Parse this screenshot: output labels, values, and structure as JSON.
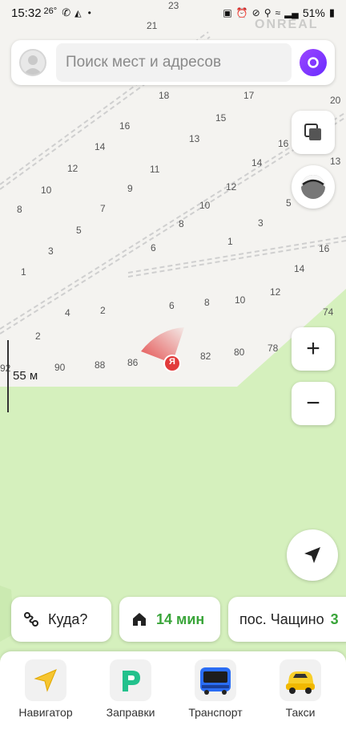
{
  "status_bar": {
    "time": "15:32",
    "temperature": "26°",
    "battery": "51%"
  },
  "watermark": "ONREAL",
  "search": {
    "placeholder": "Поиск мест и адресов"
  },
  "map": {
    "scale_label": "55 м",
    "location_marker_letter": "Я",
    "house_numbers": [
      "23",
      "21",
      "18",
      "17",
      "20",
      "16",
      "15",
      "16",
      "13",
      "14",
      "12",
      "11",
      "14",
      "12",
      "10",
      "9",
      "13",
      "8",
      "7",
      "10",
      "5",
      "3",
      "5",
      "8",
      "6",
      "1",
      "16",
      "3",
      "14",
      "1",
      "12",
      "2",
      "4",
      "6",
      "8",
      "10",
      "74",
      "2",
      "82",
      "80",
      "78",
      "92",
      "90",
      "88",
      "86"
    ]
  },
  "chips": {
    "route_label": "Куда?",
    "home_time": "14 мин",
    "place_label": "пос. Чащино",
    "place_suffix": "3"
  },
  "tabs": [
    {
      "label": "Навигатор",
      "icon": "navigator-icon"
    },
    {
      "label": "Заправки",
      "icon": "fuel-icon"
    },
    {
      "label": "Транспорт",
      "icon": "bus-icon"
    },
    {
      "label": "Такси",
      "icon": "taxi-icon"
    }
  ],
  "colors": {
    "park_green": "#d5f0bd",
    "accent_purple": "#7a36ff",
    "green_text": "#3aa53a",
    "marker_red": "#e23b3b"
  }
}
